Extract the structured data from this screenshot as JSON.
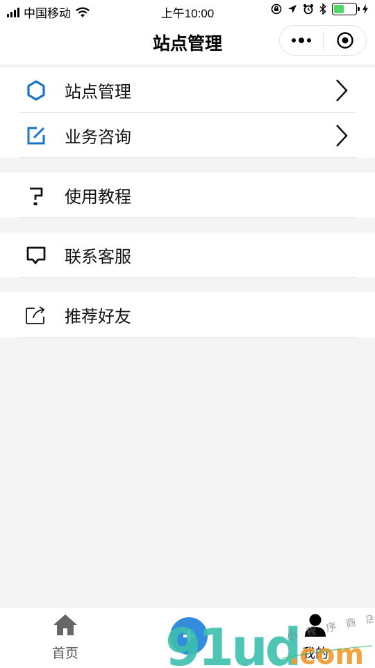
{
  "status_bar": {
    "carrier": "中国移动",
    "time": "上午10:00",
    "battery_level": 0.45
  },
  "nav": {
    "title": "站点管理"
  },
  "menu": {
    "group1": [
      {
        "label": "站点管理",
        "icon": "hexagon-icon"
      },
      {
        "label": "业务咨询",
        "icon": "edit-square-icon"
      }
    ],
    "tutorial": {
      "label": "使用教程",
      "icon": "question-mark-icon"
    },
    "service": {
      "label": "联系客服",
      "icon": "chat-bubble-icon"
    },
    "share": {
      "label": "推荐好友",
      "icon": "share-icon"
    }
  },
  "tab_bar": {
    "home": {
      "label": "首页",
      "icon": "home-icon"
    },
    "mine": {
      "label": "我的",
      "icon": "user-icon"
    }
  },
  "watermark": {
    "brand": "91ud.com",
    "small_text": "小程序商店"
  },
  "colors": {
    "accent_blue": "#1a73c8",
    "background": "#f4f4f4",
    "watermark_teal": "#3dbfae",
    "watermark_orange": "#f29b30"
  }
}
